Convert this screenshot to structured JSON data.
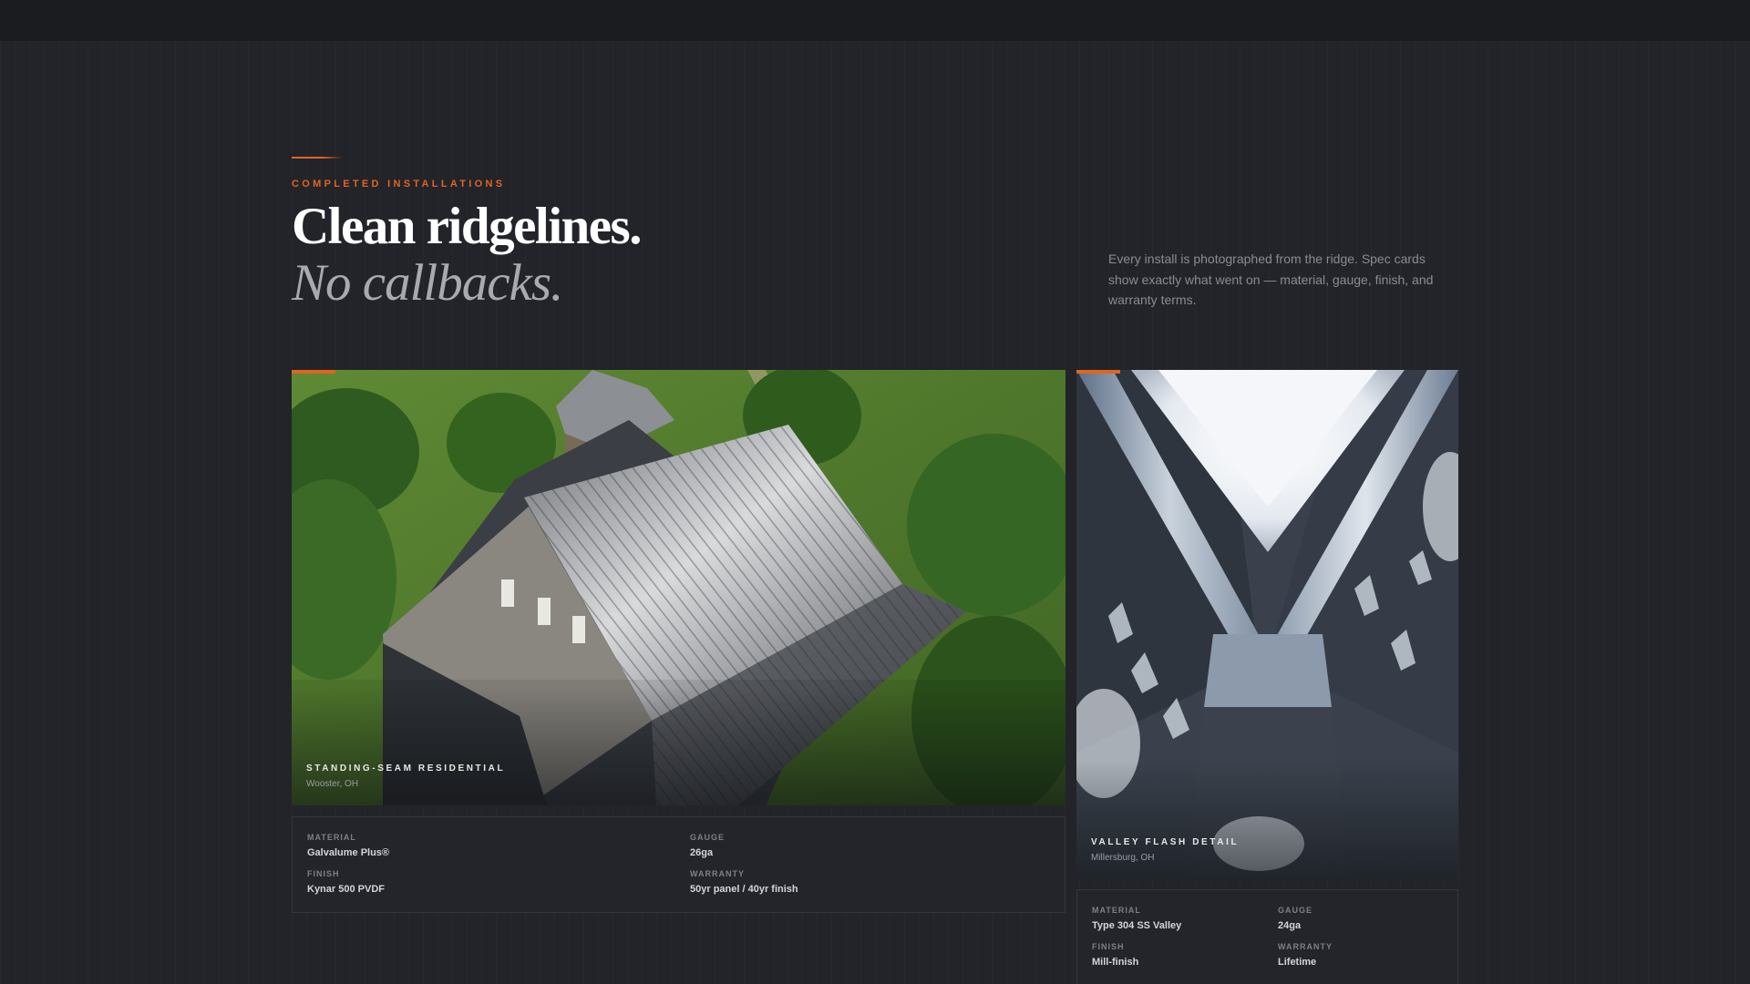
{
  "header": {
    "eyebrow": "COMPLETED INSTALLATIONS",
    "headline_line1": "Clean ridgelines.",
    "headline_line2": "No callbacks.",
    "intro": "Every install is photographed from the ridge. Spec cards show exactly what went on — material, gauge, finish, and warranty terms."
  },
  "colors": {
    "accent": "#e2641f",
    "background": "#22242a",
    "topbar": "#1b1c20"
  },
  "projects": [
    {
      "title": "STANDING-SEAM RESIDENTIAL",
      "location": "Wooster, OH",
      "specs": [
        {
          "label": "MATERIAL",
          "value": "Galvalume Plus®"
        },
        {
          "label": "GAUGE",
          "value": "26ga"
        },
        {
          "label": "FINISH",
          "value": "Kynar 500 PVDF"
        },
        {
          "label": "WARRANTY",
          "value": "50yr panel / 40yr finish"
        }
      ]
    },
    {
      "title": "VALLEY FLASH DETAIL",
      "location": "Millersburg, OH",
      "specs": [
        {
          "label": "MATERIAL",
          "value": "Type 304 SS Valley"
        },
        {
          "label": "GAUGE",
          "value": "24ga"
        },
        {
          "label": "FINISH",
          "value": "Mill-finish"
        },
        {
          "label": "WARRANTY",
          "value": "Lifetime"
        }
      ]
    }
  ]
}
